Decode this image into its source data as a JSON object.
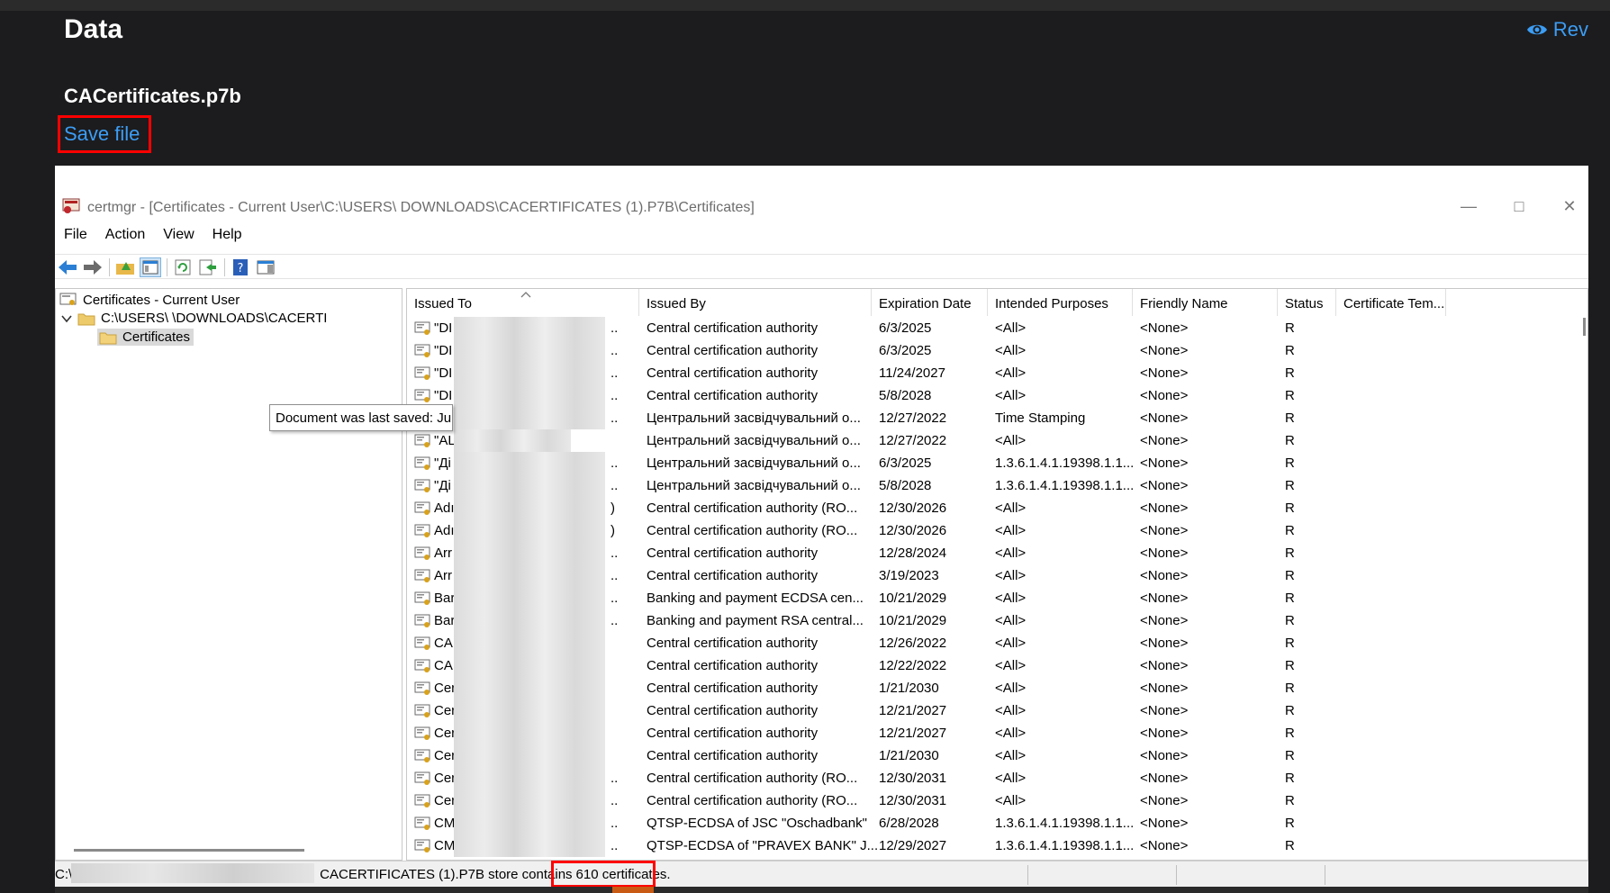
{
  "header": {
    "title": "Data",
    "review_label": "Rev",
    "file_name": "CACertificates.p7b",
    "save_label": "Save file"
  },
  "window": {
    "title": "certmgr - [Certificates - Current User\\C:\\USERS\\            DOWNLOADS\\CACERTIFICATES (1).P7B\\Certificates]",
    "menu": [
      "File",
      "Action",
      "View",
      "Help"
    ]
  },
  "tree": {
    "root": "Certificates - Current User",
    "store": "C:\\USERS\\                    \\DOWNLOADS\\CACERTI",
    "leaf": "Certificates"
  },
  "columns": [
    "Issued To",
    "Issued By",
    "Expiration Date",
    "Intended Purposes",
    "Friendly Name",
    "Status",
    "Certificate Tem..."
  ],
  "tooltip": "Document was last saved: Ju",
  "rows": [
    {
      "to": "\"DI",
      "by": "Central certification authority",
      "exp": "6/3/2025",
      "purpose": "<All>",
      "friendly": "<None>",
      "status": "R",
      "suffix": ".."
    },
    {
      "to": "\"DI",
      "by": "Central certification authority",
      "exp": "6/3/2025",
      "purpose": "<All>",
      "friendly": "<None>",
      "status": "R",
      "suffix": ".."
    },
    {
      "to": "\"DI",
      "by": "Central certification authority",
      "exp": "11/24/2027",
      "purpose": "<All>",
      "friendly": "<None>",
      "status": "R",
      "suffix": ".."
    },
    {
      "to": "\"DI",
      "by": "Central certification authority",
      "exp": "5/8/2028",
      "purpose": "<All>",
      "friendly": "<None>",
      "status": "R",
      "suffix": ".."
    },
    {
      "to": "",
      "by": "Центральний засвідчувальний о...",
      "exp": "12/27/2022",
      "purpose": "Time Stamping",
      "friendly": "<None>",
      "status": "R",
      "suffix": ".."
    },
    {
      "to": "\"AL",
      "by": "Центральний засвідчувальний о...",
      "exp": "12/27/2022",
      "purpose": "<All>",
      "friendly": "<None>",
      "status": "R",
      "suffix": ""
    },
    {
      "to": "\"Ді",
      "by": "Центральний засвідчувальний о...",
      "exp": "6/3/2025",
      "purpose": "1.3.6.1.4.1.19398.1.1...",
      "friendly": "<None>",
      "status": "R",
      "suffix": ".."
    },
    {
      "to": "\"Ді",
      "by": "Центральний засвідчувальний о...",
      "exp": "5/8/2028",
      "purpose": "1.3.6.1.4.1.19398.1.1...",
      "friendly": "<None>",
      "status": "R",
      "suffix": ".."
    },
    {
      "to": "Adı",
      "by": "Central certification authority (RO...",
      "exp": "12/30/2026",
      "purpose": "<All>",
      "friendly": "<None>",
      "status": "R",
      "suffix": ")"
    },
    {
      "to": "Adı",
      "by": "Central certification authority (RO...",
      "exp": "12/30/2026",
      "purpose": "<All>",
      "friendly": "<None>",
      "status": "R",
      "suffix": ")"
    },
    {
      "to": "Arr",
      "by": "Central certification authority",
      "exp": "12/28/2024",
      "purpose": "<All>",
      "friendly": "<None>",
      "status": "R",
      "suffix": ".."
    },
    {
      "to": "Arr",
      "by": "Central certification authority",
      "exp": "3/19/2023",
      "purpose": "<All>",
      "friendly": "<None>",
      "status": "R",
      "suffix": ".."
    },
    {
      "to": "Bar",
      "by": "Banking and payment ECDSA cen...",
      "exp": "10/21/2029",
      "purpose": "<All>",
      "friendly": "<None>",
      "status": "R",
      "suffix": ".."
    },
    {
      "to": "Bar",
      "by": "Banking and payment RSA central...",
      "exp": "10/21/2029",
      "purpose": "<All>",
      "friendly": "<None>",
      "status": "R",
      "suffix": ".."
    },
    {
      "to": "CA",
      "by": "Central certification authority",
      "exp": "12/26/2022",
      "purpose": "<All>",
      "friendly": "<None>",
      "status": "R",
      "suffix": ""
    },
    {
      "to": "CA",
      "by": "Central certification authority",
      "exp": "12/22/2022",
      "purpose": "<All>",
      "friendly": "<None>",
      "status": "R",
      "suffix": ""
    },
    {
      "to": "Cer",
      "by": "Central certification authority",
      "exp": "1/21/2030",
      "purpose": "<All>",
      "friendly": "<None>",
      "status": "R",
      "suffix": ""
    },
    {
      "to": "Cer",
      "by": "Central certification authority",
      "exp": "12/21/2027",
      "purpose": "<All>",
      "friendly": "<None>",
      "status": "R",
      "suffix": ""
    },
    {
      "to": "Cer",
      "by": "Central certification authority",
      "exp": "12/21/2027",
      "purpose": "<All>",
      "friendly": "<None>",
      "status": "R",
      "suffix": ""
    },
    {
      "to": "Cer",
      "by": "Central certification authority",
      "exp": "1/21/2030",
      "purpose": "<All>",
      "friendly": "<None>",
      "status": "R",
      "suffix": ""
    },
    {
      "to": "Cer",
      "by": "Central certification authority (RO...",
      "exp": "12/30/2031",
      "purpose": "<All>",
      "friendly": "<None>",
      "status": "R",
      "suffix": ".."
    },
    {
      "to": "Cer",
      "by": "Central certification authority (RO...",
      "exp": "12/30/2031",
      "purpose": "<All>",
      "friendly": "<None>",
      "status": "R",
      "suffix": ".."
    },
    {
      "to": "CM",
      "by": "QTSP-ECDSA of JSC \"Oschadbank\"",
      "exp": "6/28/2028",
      "purpose": "1.3.6.1.4.1.19398.1.1...",
      "friendly": "<None>",
      "status": "R",
      "suffix": ".."
    },
    {
      "to": "CM",
      "by": "QTSP-ECDSA of \"PRAVEX BANK\" J...",
      "exp": "12/29/2027",
      "purpose": "1.3.6.1.4.1.19398.1.1...",
      "friendly": "<None>",
      "status": "R",
      "suffix": ".."
    }
  ],
  "status": {
    "path_prefix": "C:\\",
    "path_suffix": "CACERTIFICATES (1).P7B store contains",
    "count": "610 certificates."
  },
  "colors": {
    "accent": "#3c9df5",
    "highlight": "#ff0000",
    "dark_bg": "#1c1c1e"
  }
}
